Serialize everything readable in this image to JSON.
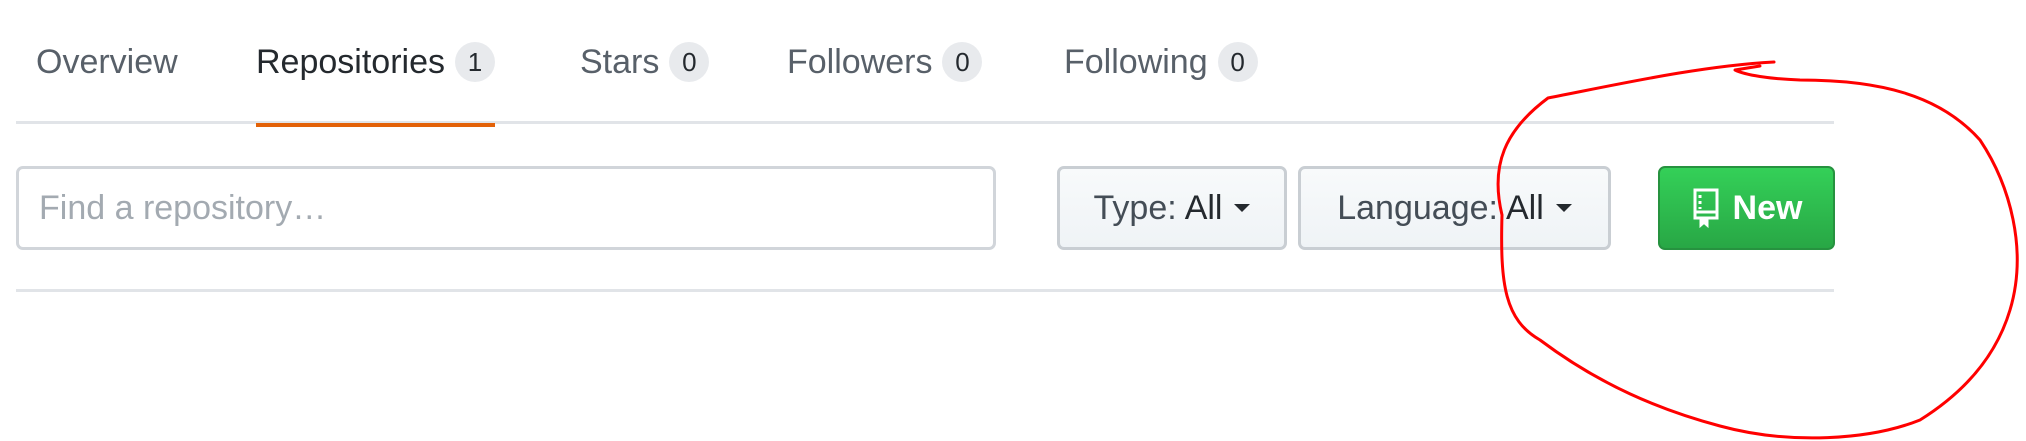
{
  "tabs": [
    {
      "label": "Overview",
      "count": null,
      "active": false
    },
    {
      "label": "Repositories",
      "count": "1",
      "active": true
    },
    {
      "label": "Stars",
      "count": "0",
      "active": false
    },
    {
      "label": "Followers",
      "count": "0",
      "active": false
    },
    {
      "label": "Following",
      "count": "0",
      "active": false
    }
  ],
  "filters": {
    "search_placeholder": "Find a repository…",
    "search_value": "",
    "type_prefix": "Type:",
    "type_value": "All",
    "language_prefix": "Language:",
    "language_value": "All",
    "new_label": "New",
    "new_icon": "repo-book-icon"
  },
  "colors": {
    "active_tab_underline": "#e36209",
    "new_button": "#2ea44f",
    "annotation": "#ff0000"
  }
}
